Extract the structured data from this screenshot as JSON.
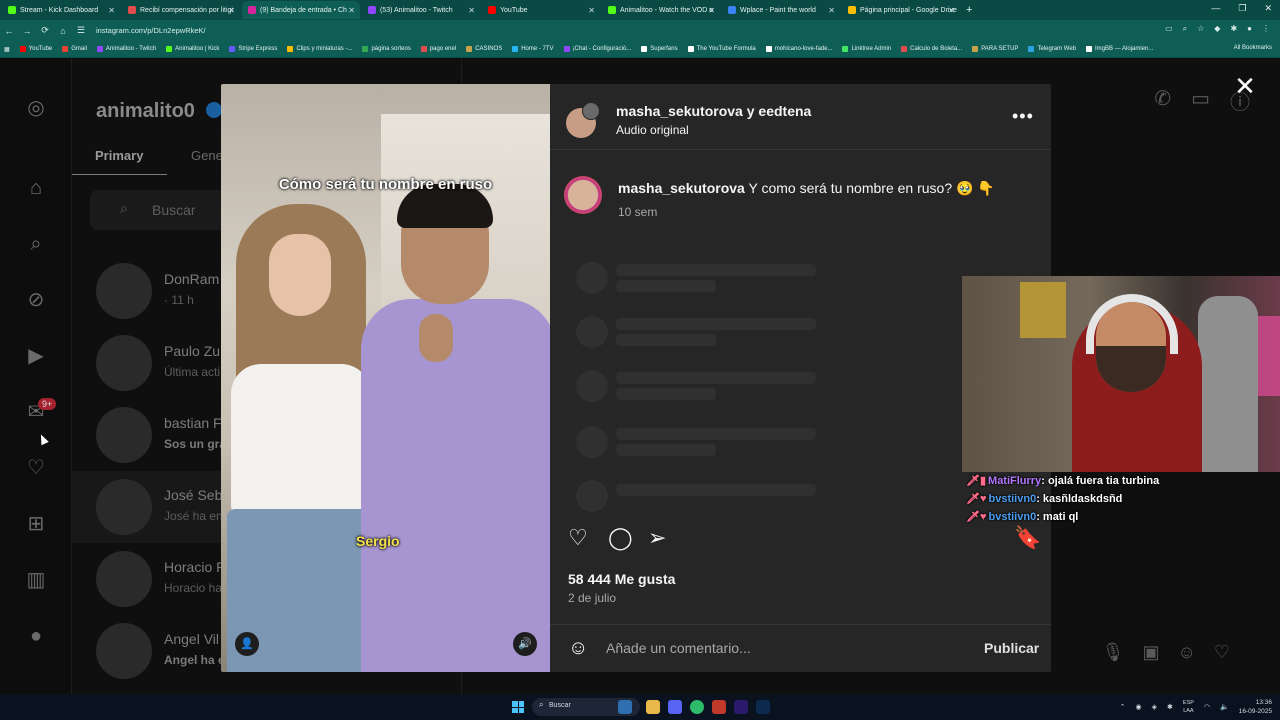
{
  "browser": {
    "tabs": [
      {
        "title": "Stream - Kick Dashboard",
        "color": "#53fc18",
        "active": false
      },
      {
        "title": "Recibí compensación por litigi",
        "color": "#e34c4c",
        "active": false
      },
      {
        "title": "(9) Bandeja de entrada • Ch",
        "color": "#d6249f",
        "active": true
      },
      {
        "title": "(53) Animalitoo - Twitch",
        "color": "#9146ff",
        "active": false
      },
      {
        "title": "YouTube",
        "color": "#ff0000",
        "active": false
      },
      {
        "title": "Animalitoo - Watch the VOD o",
        "color": "#53fc18",
        "active": false
      },
      {
        "title": "Wplace - Paint the world",
        "color": "#3b82f6",
        "active": false
      },
      {
        "title": "Página principal - Google Drive",
        "color": "#fbbc04",
        "active": false
      }
    ],
    "new_tab": "+",
    "url": "instagram.com/p/DLn2epwRkeK/",
    "bookmarks": [
      {
        "label": "YouTube",
        "color": "#ff0000"
      },
      {
        "label": "Gmail",
        "color": "#ea4335"
      },
      {
        "label": "Animalitoo - Twitch",
        "color": "#9146ff"
      },
      {
        "label": "Animalitoo | Kick",
        "color": "#53fc18"
      },
      {
        "label": "Stripe Express",
        "color": "#635bff"
      },
      {
        "label": "Clips y miniaturas -...",
        "color": "#fbbc04"
      },
      {
        "label": "página sorteos",
        "color": "#34a853"
      },
      {
        "label": "pago enel",
        "color": "#e34c4c"
      },
      {
        "label": "CASINOS",
        "color": "#c8a24a"
      },
      {
        "label": "Home - 7TV",
        "color": "#29b6f6"
      },
      {
        "label": "¡Chat - Configuració...",
        "color": "#9146ff"
      },
      {
        "label": "Superfans",
        "color": "#ffffff"
      },
      {
        "label": "The YouTube Formula",
        "color": "#ffffff"
      },
      {
        "label": "mohicano-love-fade...",
        "color": "#ffffff"
      },
      {
        "label": "Linktree Admin",
        "color": "#43e660"
      },
      {
        "label": "Calculo de Boleta...",
        "color": "#e34c4c"
      },
      {
        "label": "PARA SETUP",
        "color": "#c8a24a"
      },
      {
        "label": "Telegram Web",
        "color": "#2aa3df"
      },
      {
        "label": "ImgBB — Alojamien...",
        "color": "#ffffff"
      }
    ],
    "all_bookmarks": "All Bookmarks"
  },
  "instagram": {
    "username": "animalito0",
    "tabs": {
      "primary": "Primary",
      "general": "Gene"
    },
    "search_placeholder": "Buscar",
    "conversations": [
      {
        "name": "DonRam",
        "sub": "· 11 h",
        "bold": false
      },
      {
        "name": "Paulo Zu",
        "sub": "Última acti",
        "bold": false
      },
      {
        "name": "bastian F",
        "sub": "Sos un gra",
        "bold": true
      },
      {
        "name": "José Seba",
        "sub": "José ha en",
        "bold": false
      },
      {
        "name": "Horacio F",
        "sub": "Horacio ha",
        "bold": false
      },
      {
        "name": "Angel Vil",
        "sub": "Angel ha e",
        "bold": true
      }
    ],
    "badge": "9+"
  },
  "post": {
    "header_user": "masha_sekutorova y eedtena",
    "header_audio": "Audio original",
    "caption_user": "masha_sekutorova",
    "caption_text": " Y como será tu nombre en ruso? 🥹 👇",
    "caption_time": "10 sem",
    "video_caption": "Cómo será tu nombre en ruso",
    "video_subtitle": "Sergio",
    "likes": "58 444 Me gusta",
    "date": "2 de julio",
    "comment_placeholder": "Añade un comentario...",
    "publish": "Publicar"
  },
  "stream_chat": [
    {
      "badges": "🗡▮",
      "user": "MatiFlurry",
      "message": ": ojalá fuera tia turbina",
      "user_color": "u1"
    },
    {
      "badges": "🗡♥",
      "user": "bvstiivn0",
      "message": ": kasñldaskdsñd",
      "user_color": "u2"
    },
    {
      "badges": "🗡♥",
      "user": "bvstiivn0",
      "message": ": mati ql",
      "user_color": "u2"
    }
  ],
  "taskbar": {
    "search": "Buscar",
    "lang_top": "ESP",
    "lang_bottom": "LAA",
    "time": "13:36",
    "date": "16-09-2025"
  }
}
